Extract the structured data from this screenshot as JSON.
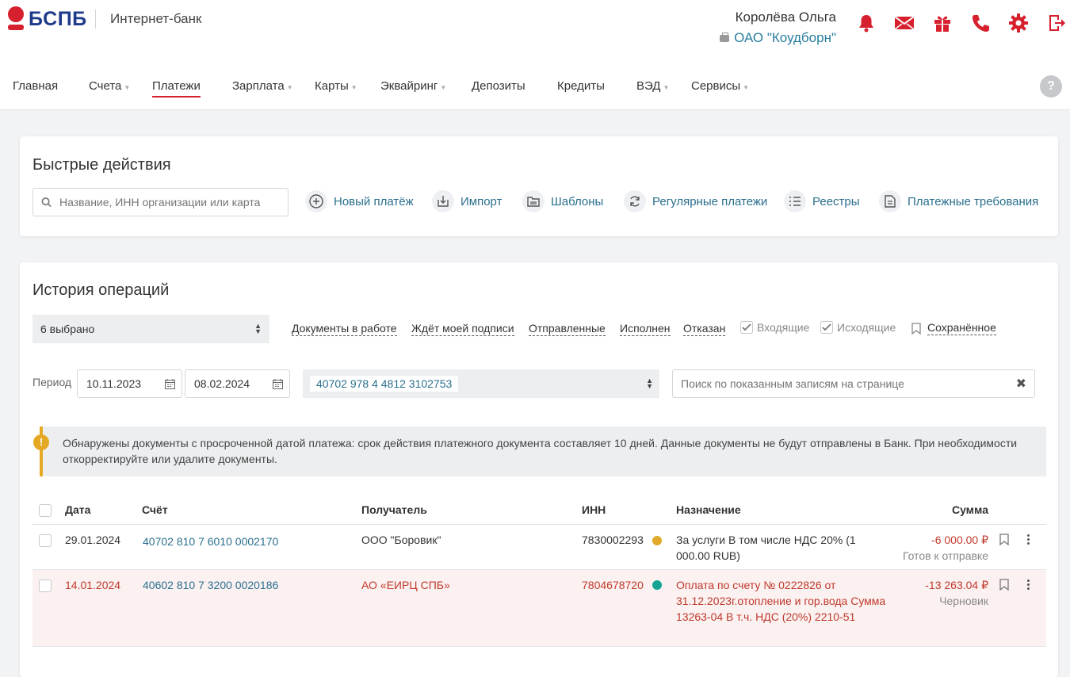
{
  "header": {
    "logo_text": "БСПБ",
    "app_name": "Интернет-банк",
    "user_name": "Королёва Ольга",
    "org_name": "ОАО \"Коудборн\"",
    "icons": [
      "bell-icon",
      "mail-icon",
      "gift-icon",
      "phone-icon",
      "gear-icon",
      "logout-icon"
    ]
  },
  "nav": {
    "items": [
      {
        "label": "Главная"
      },
      {
        "label": "Счета"
      },
      {
        "label": "Платежи",
        "active": true
      },
      {
        "label": "Зарплата"
      },
      {
        "label": "Карты"
      },
      {
        "label": "Эквайринг"
      },
      {
        "label": "Депозиты"
      },
      {
        "label": "Кредиты"
      },
      {
        "label": "ВЭД"
      },
      {
        "label": "Сервисы"
      }
    ],
    "help": "?"
  },
  "quick": {
    "title": "Быстрые действия",
    "search_placeholder": "Название, ИНН организации или карта",
    "actions": [
      {
        "label": "Новый платёж",
        "icon": "plus-circle-icon"
      },
      {
        "label": "Импорт",
        "icon": "import-icon"
      },
      {
        "label": "Шаблоны",
        "icon": "templates-icon"
      },
      {
        "label": "Регулярные платежи",
        "icon": "refresh-icon"
      },
      {
        "label": "Реестры",
        "icon": "list-icon"
      },
      {
        "label": "Платежные требования",
        "icon": "document-icon"
      }
    ]
  },
  "history": {
    "title": "История операций",
    "selected": "6 выбрано",
    "filters": [
      "Документы в работе",
      "Ждёт моей подписи",
      "Отправленные",
      "Исполнен",
      "Отказан"
    ],
    "checks": [
      "Входящие",
      "Исходящие"
    ],
    "saved": "Сохранённое",
    "period_label": "Период",
    "date_from": "10.11.2023",
    "date_to": "08.02.2024",
    "account": "40702 978 4 4812 3102753",
    "search_placeholder": "Поиск по показанным записям на странице",
    "alert": "Обнаружены документы с просроченной датой платежа: срок действия платежного документа составляет 10 дней. Данные документы не будут отправлены в Банк. При необходимости откорректируйте или удалите документы.",
    "columns": {
      "date": "Дата",
      "account": "Счёт",
      "recipient": "Получатель",
      "inn": "ИНН",
      "purpose": "Назначение",
      "amount": "Сумма"
    },
    "rows": [
      {
        "date": "29.01.2024",
        "account": "40702 810 7 6010 0002170",
        "recipient": "ООО \"Боровик\"",
        "inn": "7830002293",
        "dot_color": "#e0a92a",
        "purpose": "За услуги В том числе НДС 20% (1 000.00 RUB)",
        "amount": "-6 000.00 ₽",
        "status": "Готов к отправке"
      },
      {
        "date": "14.01.2024",
        "account": "40602 810 7 3200 0020186",
        "recipient": "АО «ЕИРЦ СПБ»",
        "inn": "7804678720",
        "dot_color": "#16a394",
        "purpose": "Оплата по счету № 0222826 от 31.12.2023г.отопление и гор.вода Сумма 13263-04 В т.ч. НДС (20%) 2210-51",
        "amount": "-13 263.04 ₽",
        "status": "Черновик"
      }
    ]
  },
  "colors": {
    "brand_red": "#d6202e",
    "link": "#2a6f8e",
    "warning": "#e5a823"
  }
}
